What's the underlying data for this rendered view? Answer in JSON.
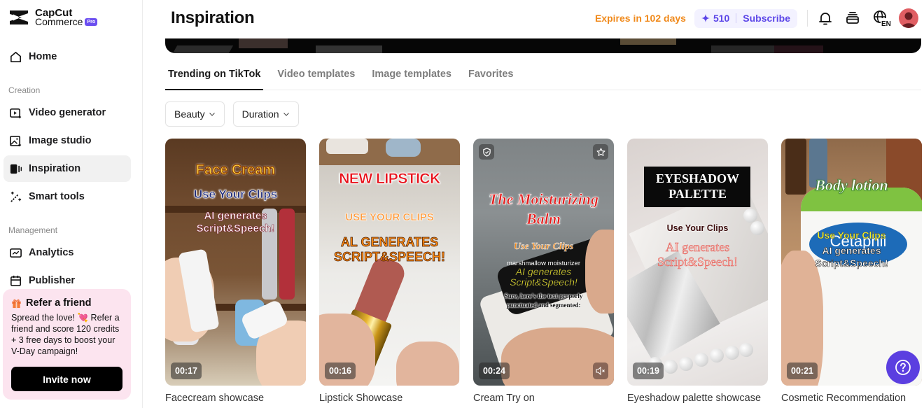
{
  "app": {
    "brand_line1": "CapCut",
    "brand_line2": "Commerce",
    "brand_badge": "Pro"
  },
  "sidebar": {
    "home": {
      "label": "Home",
      "icon": "home-icon"
    },
    "sections": [
      {
        "label": "Creation",
        "items": [
          {
            "label": "Video generator",
            "icon": "video-generator-icon"
          },
          {
            "label": "Image studio",
            "icon": "image-studio-icon"
          },
          {
            "label": "Inspiration",
            "icon": "inspiration-icon",
            "active": true
          },
          {
            "label": "Smart tools",
            "icon": "magic-wand-icon"
          }
        ]
      },
      {
        "label": "Management",
        "items": [
          {
            "label": "Analytics",
            "icon": "analytics-icon"
          },
          {
            "label": "Publisher",
            "icon": "calendar-icon"
          }
        ]
      }
    ],
    "refer": {
      "title": "Refer a friend",
      "body": "Spread the love! 💘 Refer a friend and score 120 credits + 3 free days to boost your V-Day campaign!",
      "button": "Invite now"
    }
  },
  "header": {
    "title": "Inspiration",
    "expires": "Expires in 102 days",
    "credits": "510",
    "subscribe": "Subscribe",
    "language": "EN"
  },
  "tabs": [
    {
      "label": "Trending on TikTok",
      "active": true
    },
    {
      "label": "Video templates"
    },
    {
      "label": "Image templates"
    },
    {
      "label": "Favorites"
    }
  ],
  "filters": [
    {
      "label": "Beauty"
    },
    {
      "label": "Duration"
    }
  ],
  "cards": [
    {
      "title": "Facecream showcase",
      "duration": "00:17",
      "overlay": [
        "Face Cream",
        "Use Your Clips",
        "AI generates",
        "Script&Speech!"
      ]
    },
    {
      "title": "Lipstick Showcase",
      "duration": "00:16",
      "overlay": [
        "NEW LIPSTICK",
        "USE YOUR CLIPS",
        "AL GENERATES",
        "SCRIPT&SPEECH!"
      ]
    },
    {
      "title": "Cream Try on",
      "duration": "00:24",
      "overlay": [
        "The Moisturizing",
        "Balm",
        "Use Your Clips",
        "marshmallow moisturizer",
        "AI generates",
        "Script&Speech!",
        "Sure, here's the text properly",
        "punctuated and segmented:"
      ]
    },
    {
      "title": "Eyeshadow palette showcase",
      "duration": "00:19",
      "overlay": [
        "EYESHADOW",
        "PALETTE",
        "Use Your Clips",
        "AI generates",
        "Script&Speech!"
      ]
    },
    {
      "title": "Cosmetic Recommendation",
      "duration": "00:21",
      "overlay": [
        "Body lotion",
        "Cetaphil",
        "Use Your Clips",
        "AI generates",
        "Script&Speech!"
      ]
    }
  ],
  "colors": {
    "accent": "#5b3fe0",
    "expires": "#f08a1c",
    "refer_bg": "#fce4ef"
  }
}
